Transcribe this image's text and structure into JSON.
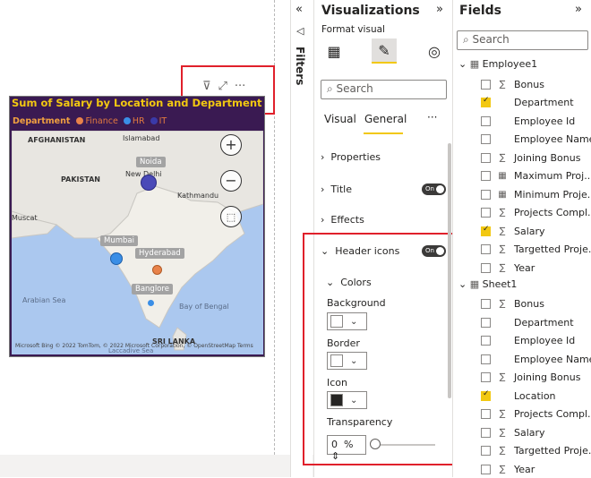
{
  "visual": {
    "title": "Sum of Salary by Location and Department",
    "legend": {
      "label": "Department",
      "items": [
        {
          "name": "Finance",
          "color": "#e8824a"
        },
        {
          "name": "HR",
          "color": "#3a8ee6"
        },
        {
          "name": "IT",
          "color": "#3a3aa8"
        }
      ]
    },
    "map_labels": {
      "afghanistan": "AFGHANISTAN",
      "islamabad": "Islamabad",
      "pakistan": "PAKISTAN",
      "new_delhi": "New Delhi",
      "kathmandu": "Kathmandu",
      "muscat": "Muscat",
      "arabian_sea": "Arabian Sea",
      "bay_of_bengal": "Bay of Bengal",
      "sri_lanka": "SRI LANKA",
      "laccadive": "Laccadive Sea"
    },
    "cities": {
      "noida": "Noida",
      "mumbai": "Mumbai",
      "hyderabad": "Hyderabad",
      "banglore": "Banglore"
    },
    "attribution": "Microsoft Bing  © 2022 TomTom, © 2022 Microsoft Corporation, © OpenStreetMap  Terms",
    "header_icons": [
      "filter-icon",
      "focus-mode-icon",
      "more-options-icon"
    ]
  },
  "filters": {
    "label": "Filters"
  },
  "visualizations": {
    "title": "Visualizations",
    "format_label": "Format visual",
    "search_placeholder": "Search",
    "tabs": [
      "Visual",
      "General"
    ],
    "active_tab": "General",
    "more": "···",
    "sections": {
      "properties": "Properties",
      "title": "Title",
      "effects": "Effects",
      "header_icons": "Header icons"
    },
    "toggle_on": "On",
    "colors": {
      "label": "Colors",
      "background": "Background",
      "border": "Border",
      "icon": "Icon",
      "transparency": "Transparency",
      "transparency_value": "0",
      "percent": "%",
      "background_color": "#ffffff",
      "border_color": "#ffffff",
      "icon_color": "#252423"
    }
  },
  "fields": {
    "title": "Fields",
    "search_placeholder": "Search",
    "tables": [
      {
        "name": "Employee1",
        "fields": [
          {
            "name": "Bonus",
            "type": "sigma",
            "checked": false
          },
          {
            "name": "Department",
            "type": "text",
            "checked": true
          },
          {
            "name": "Employee Id",
            "type": "text",
            "checked": false
          },
          {
            "name": "Employee Name",
            "type": "text",
            "checked": false
          },
          {
            "name": "Joining Bonus",
            "type": "sigma",
            "checked": false
          },
          {
            "name": "Maximum Proj...",
            "type": "calc",
            "checked": false
          },
          {
            "name": "Minimum Proje...",
            "type": "calc",
            "checked": false
          },
          {
            "name": "Projects Compl...",
            "type": "sigma",
            "checked": false
          },
          {
            "name": "Salary",
            "type": "sigma",
            "checked": true
          },
          {
            "name": "Targetted Proje...",
            "type": "sigma",
            "checked": false
          },
          {
            "name": "Year",
            "type": "sigma",
            "checked": false
          }
        ]
      },
      {
        "name": "Sheet1",
        "fields": [
          {
            "name": "Bonus",
            "type": "sigma",
            "checked": false
          },
          {
            "name": "Department",
            "type": "text",
            "checked": false
          },
          {
            "name": "Employee Id",
            "type": "text",
            "checked": false
          },
          {
            "name": "Employee Name",
            "type": "text",
            "checked": false
          },
          {
            "name": "Joining Bonus",
            "type": "sigma",
            "checked": false
          },
          {
            "name": "Location",
            "type": "text",
            "checked": true
          },
          {
            "name": "Projects Compl...",
            "type": "sigma",
            "checked": false
          },
          {
            "name": "Salary",
            "type": "sigma",
            "checked": false
          },
          {
            "name": "Targetted Proje...",
            "type": "sigma",
            "checked": false
          },
          {
            "name": "Year",
            "type": "sigma",
            "checked": false
          }
        ]
      }
    ]
  }
}
